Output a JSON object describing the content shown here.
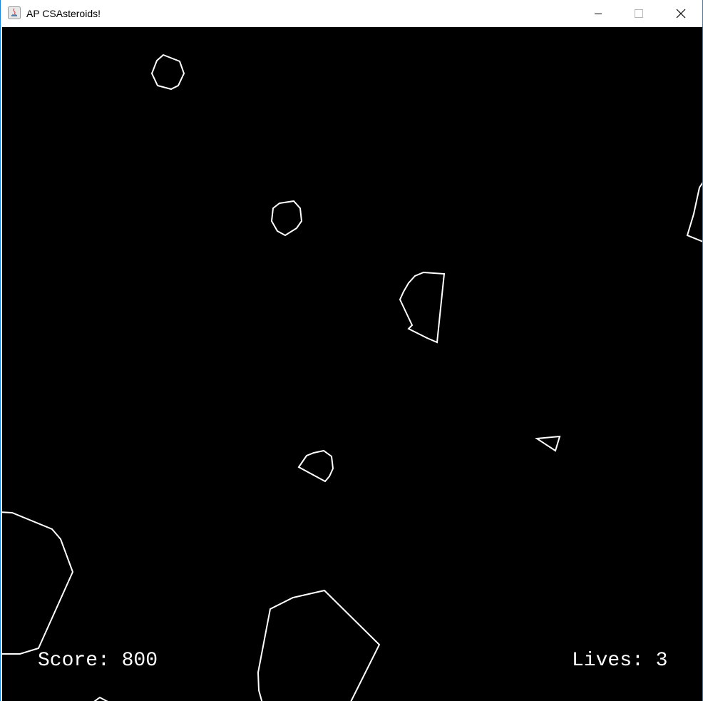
{
  "window": {
    "title": "AP CSAsteroids!",
    "controls": [
      "minimize",
      "maximize",
      "close"
    ]
  },
  "hud": {
    "score_text": "Score: 800",
    "lives_text": "Lives: 3",
    "score": 800,
    "lives": 3
  },
  "colors": {
    "background": "#000000",
    "stroke": "#ffffff",
    "window_border": "#1883d7"
  },
  "game_objects": {
    "asteroids": 8,
    "ship": 1
  }
}
